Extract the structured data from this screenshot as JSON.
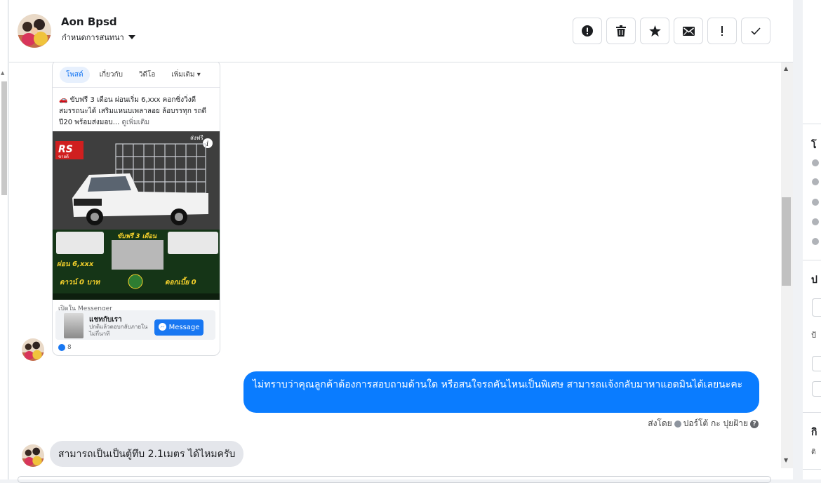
{
  "header": {
    "contact_name": "Aon Bpsd",
    "conversation_settings_label": "กำหนดการสนทนา"
  },
  "toolbar": {
    "spam_icon": "exclamation-circle-icon",
    "delete_icon": "trash-icon",
    "star_icon": "star-icon",
    "unread_icon": "envelope-icon",
    "important_icon": "exclamation-icon",
    "done_icon": "check-icon"
  },
  "shared_post": {
    "tabs": [
      "โพสต์",
      "เกี่ยวกับ",
      "วิดีโอ",
      "เพิ่มเติม"
    ],
    "text_line1": "🚗 ขับฟรี 3 เดือน ผ่อนเริ่ม 6,xxx คอกซิ่งวิ่งดี",
    "text_line2": "สมรรถนะได้ เสริมแหนบเพลาลอย ล้อบรรทุก รถดี",
    "text_line3": "ปี20 พร้อมส่งมอบ...",
    "see_more": "ดูเพิ่มเติม",
    "ad_badge": "ส่งฟรี",
    "ad_brand": "RS",
    "ad_brand_sub": "ขายดี",
    "ad_free_months": "ขับฟรี 3 เดือน",
    "ad_installment": "ผ่อน 6,xxx",
    "ad_down": "ดาวน์ 0 บาท",
    "ad_interest": "ดอกเบี้ย 0",
    "open_in_messenger": "เปิดใน Messenger",
    "chat_title": "แชทกับเรา",
    "chat_sub": "ปกติแล้วตอบกลับภายใน ไม่กี่นาที",
    "message_button": "Message",
    "like_count": "8"
  },
  "messages": {
    "outgoing_text": "ไม่ทราบว่าคุณลูกค้าต้องการสอบถามด้านใด หรือสนใจรถคันไหนเป็นพิเศษ สามารถแจ้งกลับมาหาแอดมินได้เลยนะคะ",
    "sent_by_prefix": "ส่งโดย",
    "sent_by_name": "ปอร์โต้ กะ ปุยฝ้าย",
    "incoming_text": "สามารถเป็นเป็นตู้ทึบ 2.1เมตร ได้ไหมครับ"
  },
  "right_panel": {
    "section_1_initial": "โ",
    "section_2_initial": "ป",
    "section_2_sub": "ป้",
    "section_3_initial": "กิ",
    "section_3_sub": "ติ"
  },
  "colors": {
    "brand_blue": "#1877f2",
    "outgoing_bubble": "#0a7cff",
    "incoming_bubble": "#e4e6eb"
  }
}
